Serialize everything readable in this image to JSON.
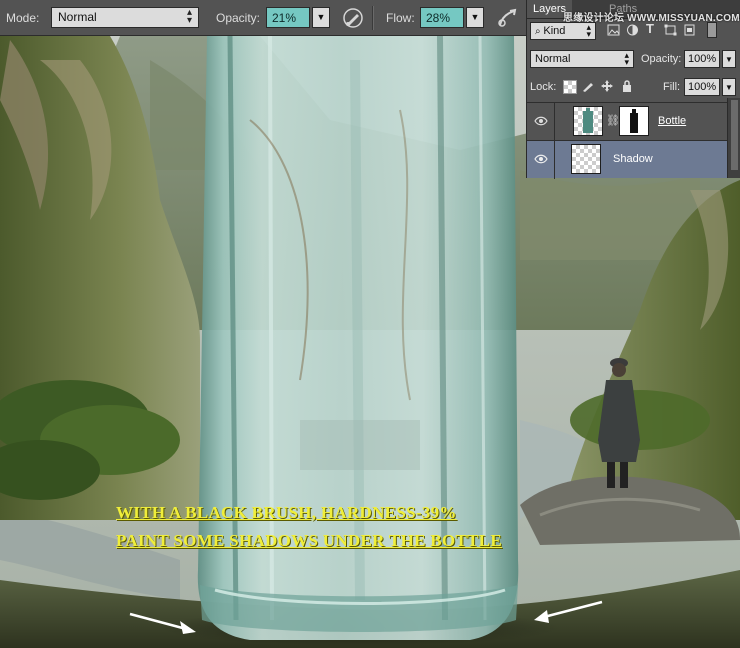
{
  "options_bar": {
    "mode_label": "Mode:",
    "mode_value": "Normal",
    "opacity_label": "Opacity:",
    "opacity_value": "21%",
    "flow_label": "Flow:",
    "flow_value": "28%",
    "airbrush_icon": "brush-pressure-icon",
    "tablet_icon": "tablet-pressure-icon"
  },
  "layers_panel": {
    "tab_active": "Layers",
    "tab_inactive": "Paths",
    "filter_label": "Kind",
    "blend_mode": "Normal",
    "opacity_label": "Opacity:",
    "opacity_value": "100%",
    "lock_label": "Lock:",
    "fill_label": "Fill:",
    "fill_value": "100%",
    "layers": [
      {
        "name": "Bottle",
        "visible": true,
        "selected": false,
        "has_mask": true
      },
      {
        "name": "Shadow",
        "visible": true,
        "selected": true,
        "has_mask": false
      }
    ]
  },
  "overlay": {
    "watermark": "思缘设计论坛 WWW.MISSYUAN.COM",
    "caption_line1": "WITH A BLACK BRUSH, HARDNESS-39%",
    "caption_line2": "PAINT SOME SHADOWS UNDER THE BOTTLE"
  },
  "colors": {
    "panel_bg": "#535353",
    "value_highlight": "#75c8c2",
    "selected_layer": "#6d7a93",
    "caption": "#f0ee3a",
    "arrow": "#ffffff"
  }
}
